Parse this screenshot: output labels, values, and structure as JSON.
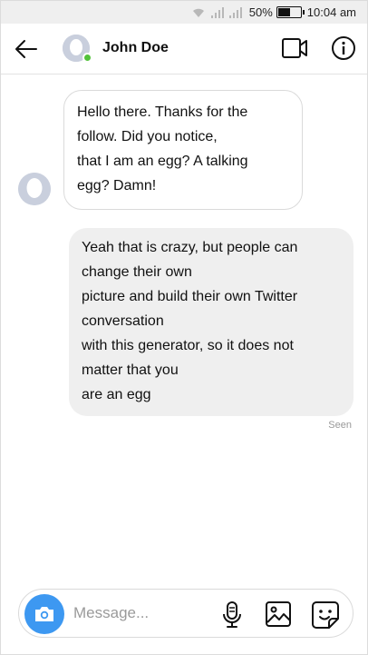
{
  "status_bar": {
    "battery_percent": "50%",
    "battery_level": 0.5,
    "time": "10:04 am",
    "icons": [
      "wifi-icon",
      "signal-icon",
      "signal-icon",
      "battery-icon"
    ]
  },
  "header": {
    "back_icon": "arrow-left-icon",
    "contact_name": "John Doe",
    "online_status_color": "#52c23a",
    "video_icon": "video-camera-icon",
    "info_icon": "info-icon"
  },
  "messages": [
    {
      "direction": "received",
      "lines": [
        "Hello there. Thanks for the",
        "follow. Did you notice,",
        "that I am an egg? A talking",
        "egg? Damn!"
      ]
    },
    {
      "direction": "sent",
      "lines": [
        "Yeah that is crazy, but people can",
        "change their own",
        "picture and build their own Twitter",
        "conversation",
        "with this generator, so it does not",
        "matter that you",
        "are an egg"
      ],
      "status": "Seen"
    }
  ],
  "composer": {
    "placeholder": "Message...",
    "value": "",
    "camera_icon": "camera-icon",
    "camera_button_color": "#3d98f1",
    "mic_icon": "microphone-icon",
    "image_icon": "image-icon",
    "sticker_icon": "sticker-icon"
  }
}
